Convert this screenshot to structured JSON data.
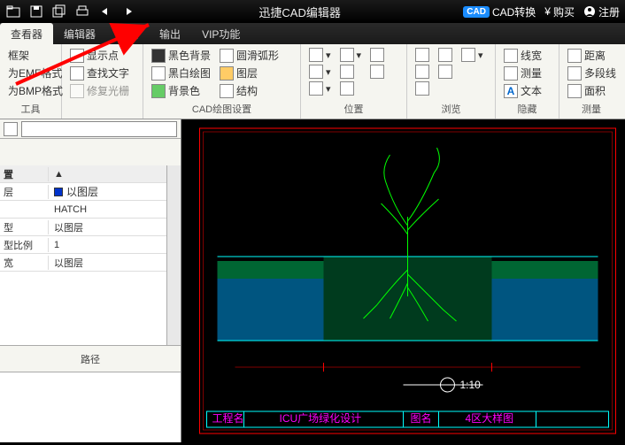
{
  "titlebar": {
    "app_title": "迅捷CAD编辑器",
    "cad_badge": "CAD",
    "convert": "CAD转换",
    "buy": "购买",
    "register": "注册"
  },
  "menu": {
    "view": "查看器",
    "editor": "编辑器",
    "advanced": "高级",
    "output": "输出",
    "vip": "VIP功能"
  },
  "ribbon": {
    "g1": {
      "frame": "框架",
      "emf": "为EMF格式",
      "bmp": "为BMP格式",
      "label": "工具"
    },
    "g2": {
      "showpt": "显示点",
      "findtxt": "查找文字",
      "fixcursor": "修复光栅"
    },
    "g3": {
      "blackbg": "黑色背景",
      "bwdraw": "黑白绘图",
      "bgcolor": "背景色",
      "smootharc": "圆滑弧形",
      "layer": "图层",
      "struct": "结构",
      "label": "CAD绘图设置"
    },
    "g4": {
      "label": "位置"
    },
    "g5": {
      "label": "浏览"
    },
    "g6": {
      "linew": "线宽",
      "measure": "测量",
      "text": "文本",
      "label": "隐藏"
    },
    "g7": {
      "dist": "距离",
      "polyline": "多段线",
      "area": "面积",
      "label": "测量"
    }
  },
  "props": {
    "hdr": "置",
    "rows": [
      {
        "k": "层",
        "v": "以图层",
        "color": true
      },
      {
        "k": "",
        "v": "HATCH"
      },
      {
        "k": "型",
        "v": "以图层"
      },
      {
        "k": "型比例",
        "v": "1"
      },
      {
        "k": "宽",
        "v": "以图层"
      }
    ],
    "path": "路径"
  },
  "drawing": {
    "scale": "1:10",
    "titleblock": {
      "proj": "工程名",
      "design": "ICU广场绿化设计",
      "drawing": "图名",
      "detail": "4区大样图"
    }
  }
}
